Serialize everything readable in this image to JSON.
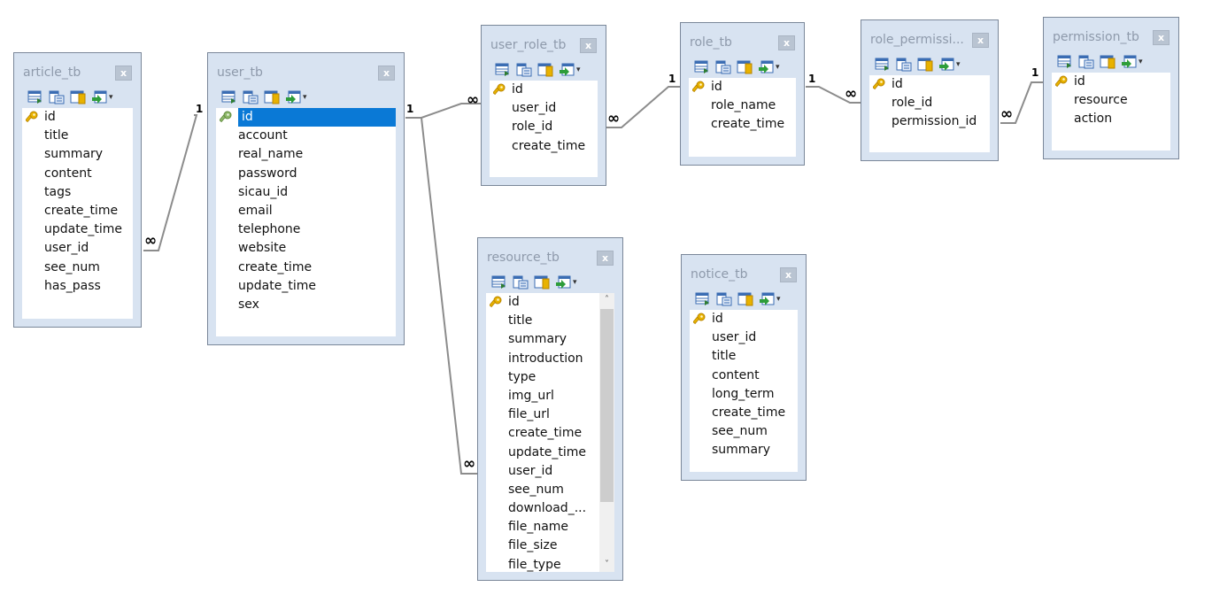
{
  "tables": {
    "article": {
      "title": "article_tb",
      "columns": [
        "id",
        "title",
        "summary",
        "content",
        "tags",
        "create_time",
        "update_time",
        "user_id",
        "see_num",
        "has_pass"
      ]
    },
    "user": {
      "title": "user_tb",
      "columns": [
        "id",
        "account",
        "real_name",
        "password",
        "sicau_id",
        "email",
        "telephone",
        "website",
        "create_time",
        "update_time",
        "sex"
      ]
    },
    "user_role": {
      "title": "user_role_tb",
      "columns": [
        "id",
        "user_id",
        "role_id",
        "create_time"
      ]
    },
    "role": {
      "title": "role_tb",
      "columns": [
        "id",
        "role_name",
        "create_time"
      ]
    },
    "role_permission": {
      "title": "role_permissi...",
      "columns": [
        "id",
        "role_id",
        "permission_id"
      ]
    },
    "permission": {
      "title": "permission_tb",
      "columns": [
        "id",
        "resource",
        "action"
      ]
    },
    "resource": {
      "title": "resource_tb",
      "columns": [
        "id",
        "title",
        "summary",
        "introduction",
        "type",
        "img_url",
        "file_url",
        "create_time",
        "update_time",
        "user_id",
        "see_num",
        "download_...",
        "file_name",
        "file_size",
        "file_type"
      ]
    },
    "notice": {
      "title": "notice_tb",
      "columns": [
        "id",
        "user_id",
        "title",
        "content",
        "long_term",
        "create_time",
        "see_num",
        "summary"
      ]
    }
  },
  "ui": {
    "close_label": "x",
    "dropdown_glyph": "▾",
    "scroll_up": "˄",
    "scroll_down": "˅",
    "one_label": "1",
    "many_label": "∞"
  },
  "colors": {
    "selected_row": "#0a79d6",
    "card_background": "#d8e3f1",
    "key_icon": "#e8b200",
    "connector": "#8c8c8c"
  }
}
